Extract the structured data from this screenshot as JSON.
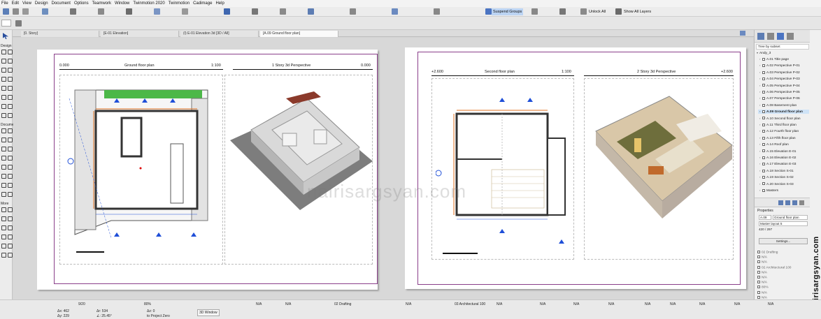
{
  "menu": [
    "File",
    "Edit",
    "View",
    "Design",
    "Document",
    "Options",
    "Teamwork",
    "Window",
    "Twinmotion 2020",
    "Twinmotion",
    "Cadimage",
    "Help"
  ],
  "toolbar": {
    "suspend_groups": "Suspend Groups",
    "unlock_all": "Unlock All",
    "show_all_layers": "Show All Layers"
  },
  "tabs": [
    "[0. Story]",
    "[E-01 Elevation]",
    "(I) E-01 Elevation 3d [3D / All]",
    "[A.09 Ground floor plan]"
  ],
  "left_toolbox": {
    "design_label": "Design",
    "document_label": "Document",
    "more_label": "More"
  },
  "sheets": {
    "left": {
      "elev_left": "0.000",
      "title_left": "Ground floor plan",
      "scale_left": "1:100",
      "title_right": "1 Story 3d Perspective",
      "elev_right": "0.000"
    },
    "right": {
      "elev_left": "+2.600",
      "title_left": "Second floor plan",
      "scale_left": "1:100",
      "title_right": "2 Story 3d Perspective",
      "elev_right": "+2.600"
    }
  },
  "watermark": "nairisargsyan.com",
  "navigator": {
    "view_mode": "Tree by subset",
    "root": "Andy_3",
    "items": [
      "A.01 Title page",
      "A.02 Perspective P-01",
      "A.03 Perspective P-02",
      "A.04 Perspective P-03",
      "A.05 Perspective P-04",
      "A.06 Perspective P-05",
      "A.07 Perspective P-06",
      "A.08 Basement plan",
      "A.09 Ground floor plan",
      "A.10 Second floor plan",
      "A.11 Third floor plan",
      "A.12 Fourth floor plan",
      "A.13 Fifth floor plan",
      "A.14 Roof plan",
      "A.15 Elevation E-01",
      "A.16 Elevation E-02",
      "A.17 Elevation E-03",
      "A.18 Section S-01",
      "A.19 Section S-02",
      "A.20 Section S-03",
      "Masters"
    ],
    "selected_index": 8
  },
  "properties": {
    "header": "Properties",
    "id": "A.09",
    "name": "Ground floor plan",
    "master": "Master layout 5",
    "size": "420 / 297",
    "settings_button": "Settings..."
  },
  "layers_panel": {
    "items": [
      "02 Drafting",
      "N/A",
      "N/A",
      "02 Architectural 100",
      "N/A",
      "N/A",
      "N/A",
      "80%",
      "N/A",
      "N/A"
    ]
  },
  "statusbar": {
    "page": "9/20",
    "zoom": "80%",
    "dx_label": "Δx: 462",
    "dy_label": "Δy: 229",
    "r_label": "Δr: 534",
    "a_label": "∠: 25.45°",
    "dz_label": "Δz: 0",
    "to_project_zero": "to Project Zero",
    "three_d_window": "3D Window",
    "na": "N/A",
    "drafting": "02 Drafting",
    "architectural": "03 Architectural 100"
  },
  "colors": {
    "sheet_frame": "#8a3e8a",
    "selected_item_bg": "#cfe3f7",
    "accent_blue": "#1f4fd8",
    "orange_dim": "#e07020"
  }
}
